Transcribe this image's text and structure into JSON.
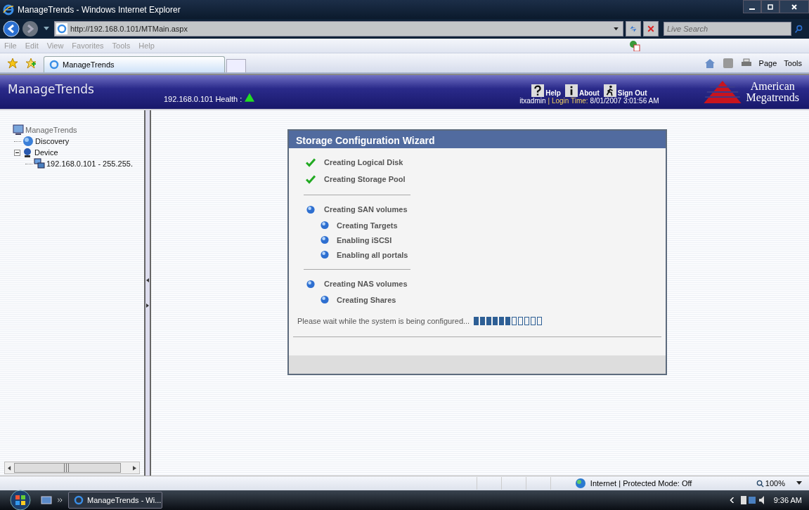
{
  "window": {
    "title": "ManageTrends - Windows Internet Explorer",
    "address": "http://192.168.0.101/MTMain.aspx",
    "search": {
      "placeholder": "Live Search"
    }
  },
  "menu": [
    "File",
    "Edit",
    "View",
    "Favorites",
    "Tools",
    "Help"
  ],
  "tabs": [
    {
      "label": "ManageTrends",
      "selected": true
    }
  ],
  "command_bar": [
    "Page",
    "Tools"
  ],
  "header": {
    "app_name": "ManageTrends",
    "host_health": "192.168.0.101 Health :",
    "links": [
      "Help",
      "About",
      "Sign Out"
    ],
    "user": "itxadmin",
    "login_label": "| Login Time:",
    "login_time": "8/01/2007 3:01:56 AM",
    "logo": [
      "American",
      "Megatrends"
    ]
  },
  "tree": {
    "label": "ManageTrends",
    "children": [
      {
        "label": "Discovery",
        "kind": "discovery"
      },
      {
        "label": "Device",
        "kind": "device",
        "expanded": true,
        "children": [
          {
            "label": "192.168.0.101 - 255.255.",
            "kind": "host"
          }
        ]
      }
    ]
  },
  "wizard": {
    "title": "Storage Configuration Wizard",
    "groups": [
      {
        "steps": [
          {
            "label": "Creating Logical Disk",
            "kind": "done"
          },
          {
            "label": "Creating Storage Pool",
            "kind": "done"
          }
        ]
      },
      {
        "steps": [
          {
            "label": "Creating SAN volumes",
            "kind": "pending",
            "children": [
              {
                "label": "Creating Targets",
                "kind": "pending"
              },
              {
                "label": "Enabling iSCSI",
                "kind": "pending"
              },
              {
                "label": "Enabling all portals",
                "kind": "pending"
              }
            ]
          }
        ]
      },
      {
        "steps": [
          {
            "label": "Creating NAS volumes",
            "kind": "pending",
            "children": [
              {
                "label": "Creating Shares",
                "kind": "pending"
              }
            ]
          }
        ]
      }
    ],
    "progress": {
      "message": "Please wait while the system is being configured...",
      "level": 0.545
    }
  },
  "status_bar": {
    "zone": "Internet | Protected Mode: Off",
    "zoom": "100%"
  },
  "taskbar": {
    "tasks": [
      "ManageTrends - Wi..."
    ],
    "clock": "9:36 AM"
  }
}
